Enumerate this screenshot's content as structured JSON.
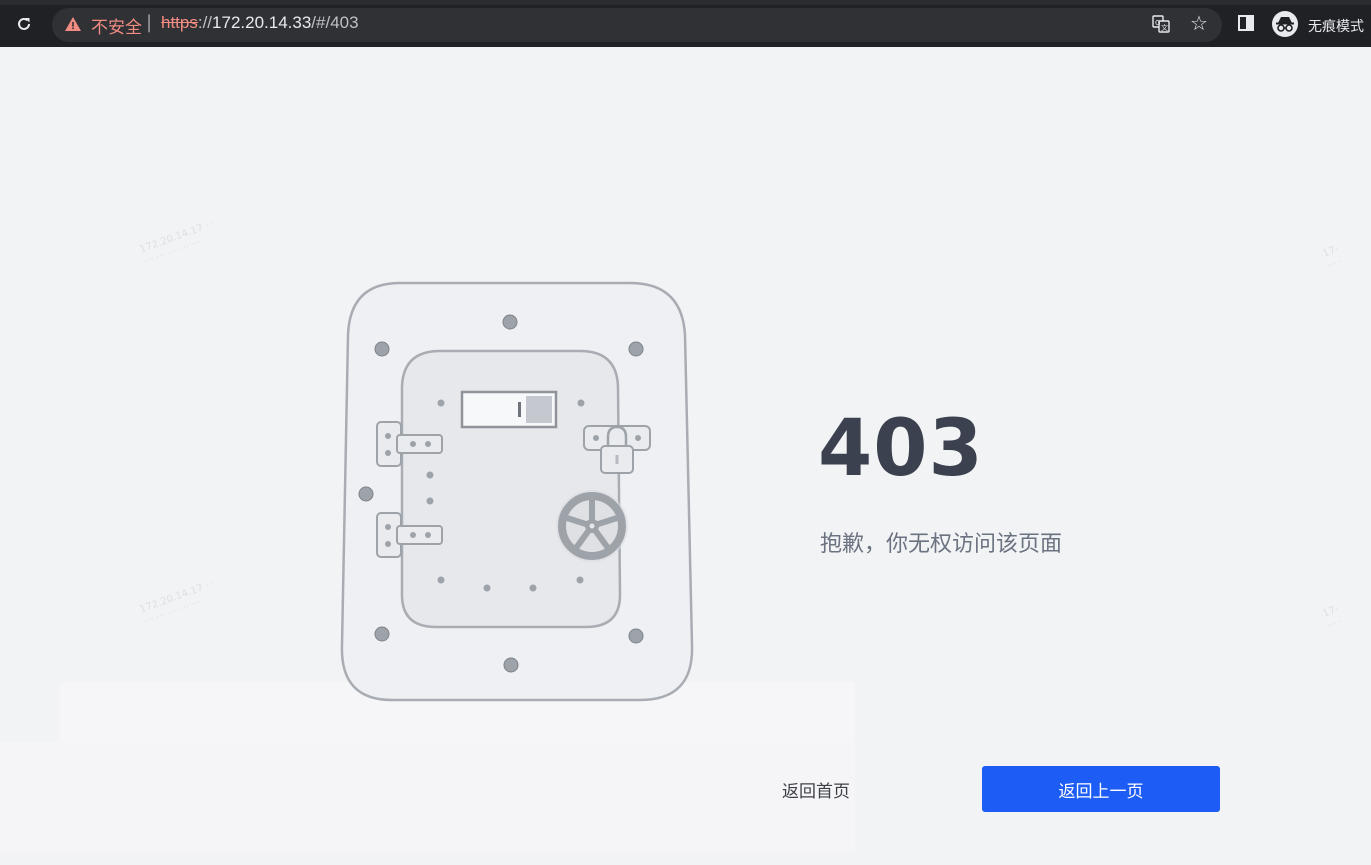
{
  "browser": {
    "reload_icon": "reload-icon",
    "security_label": "不安全",
    "separator": "|",
    "url_protocol": "https",
    "url_rest_prefix": "://",
    "url_host": "172.20.14.33",
    "url_path": "/#/403",
    "incognito_label": "无痕模式",
    "accent_color": "#f28b82"
  },
  "error": {
    "code": "403",
    "message": "抱歉，你无权访问该页面"
  },
  "actions": {
    "home_label": "返回首页",
    "back_label": "返回上一页",
    "primary_color": "#1d5cf5"
  }
}
